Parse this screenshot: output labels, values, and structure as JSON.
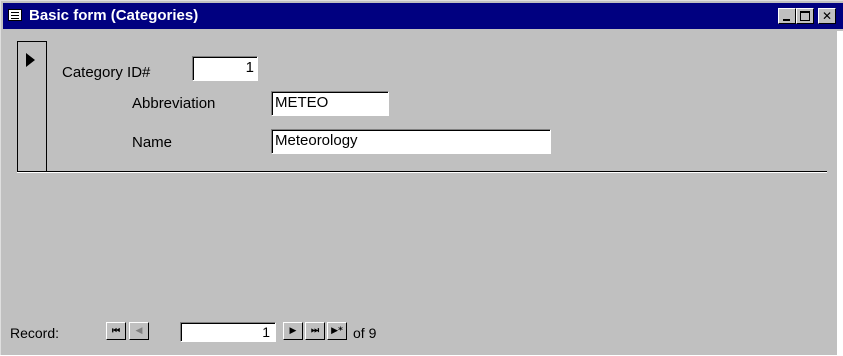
{
  "window": {
    "title": "Basic form (Categories)",
    "icon": "form-icon",
    "controls": [
      "minimize-icon",
      "maximize-icon",
      "close-icon"
    ]
  },
  "form": {
    "category_id_label": "Category ID#",
    "category_id_value": "1",
    "abbreviation_label": "Abbreviation",
    "abbreviation_value": "METEO",
    "name_label": "Name",
    "name_value": "Meteorology"
  },
  "navigation": {
    "record_label": "Record:",
    "first_glyph": "⏮",
    "prev_glyph": "◀",
    "current_record": "1",
    "next_glyph": "▶",
    "last_glyph": "⏭",
    "new_glyph": "▶*",
    "of_text": "of 9"
  },
  "colors": {
    "titlebar": "#000080",
    "window_bg": "#c0c0c0",
    "field_bg": "#ffffff"
  }
}
